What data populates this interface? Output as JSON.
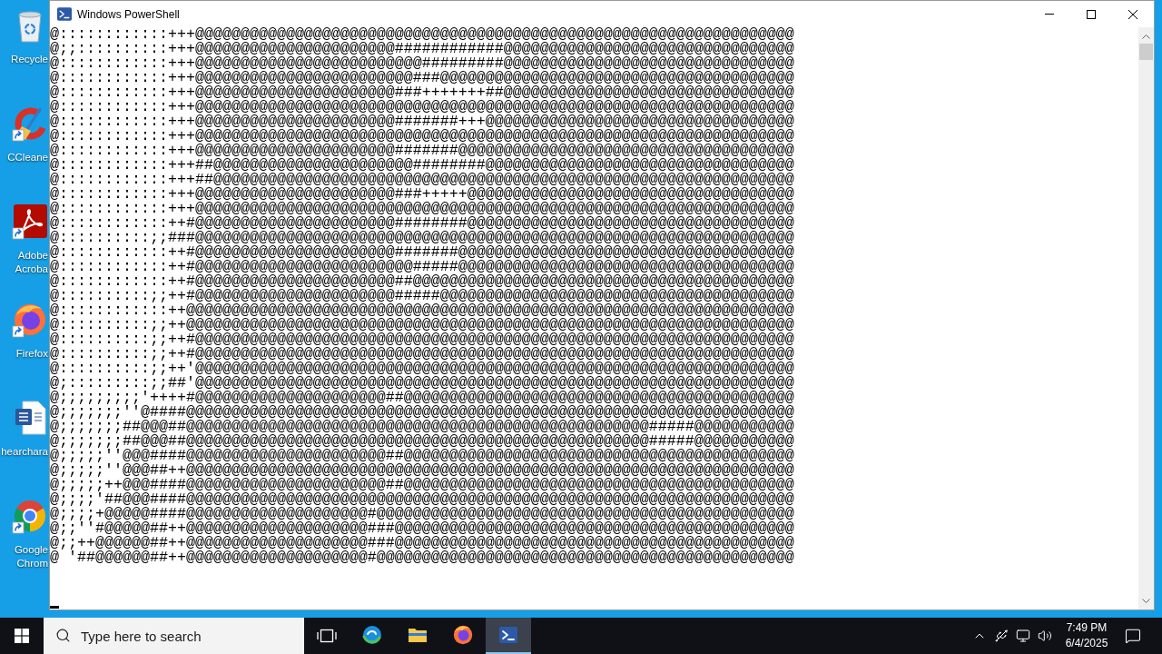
{
  "desktop": {
    "icons": [
      {
        "kind": "bin",
        "shortcut": false,
        "label": [
          "Recycle"
        ]
      },
      {
        "kind": "cleaner",
        "shortcut": true,
        "label": [
          "CCleane"
        ]
      },
      {
        "kind": "pdf",
        "shortcut": true,
        "label": [
          "Adobe",
          "Acroba"
        ]
      },
      {
        "kind": "firefox",
        "shortcut": true,
        "label": [
          "Firefox"
        ]
      },
      {
        "kind": "word",
        "shortcut": false,
        "label": [
          "hearchara"
        ]
      },
      {
        "kind": "chrome",
        "shortcut": true,
        "label": [
          "Google",
          "Chrom"
        ]
      }
    ]
  },
  "window": {
    "title": "Windows PowerShell",
    "console_lines": [
      "@::::::::::::+++@@@@@@@@@@@@@@@@@@@@@@@@@@@@@@@@@@@@@@@@@@@@@@@@@@@@@@@@@@@@@@@@@@",
      "@;;::::::::::+++@@@@@@@@@@@@@@@@@@@@@@############@@@@@@@@@@@@@@@@@@@@@@@@@@@@@@@@",
      "@::::::::::::+++@@@@@@@@@@@@@@@@@@@@@@@@@#########@@@@@@@@@@@@@@@@@@@@@@@@@@@@@@@@",
      "@::::::::::::+++@@@@@@@@@@@@@@@@@@@@@@@@###@@@@@@@@@@@@@@@@@@@@@@@@@@@@@@@@@@@@@@@",
      "@::::::::::::+++@@@@@@@@@@@@@@@@@@@@@@###+++++++##@@@@@@@@@@@@@@@@@@@@@@@@@@@@@@@@",
      "@::::::::::::+++@@@@@@@@@@@@@@@@@@@@@@@@@@@@@@@@@@@@@@@@@@@@@@@@@@@@@@@@@@@@@@@@@@",
      "@::::::::::::+++@@@@@@@@@@@@@@@@@@@@@@#######+++@@@@@@@@@@@@@@@@@@@@@@@@@@@@@@@@@@",
      "@::::::::::::+++@@@@@@@@@@@@@@@@@@@@@@@@@@@@@@@@@@@@@@@@@@@@@@@@@@@@@@@@@@@@@@@@@@",
      "@::::::::::::+++@@@@@@@@@@@@@@@@@@@@@@#######@@@@@@@@@@@@@@@@@@@@@@@@@@@@@@@@@@@@@",
      "@::::::::::::+++##@@@@@@@@@@@@@@@@@@@@@@########@@@@@@@@@@@@@@@@@@@@@@@@@@@@@@@@@@",
      "@::::::::::::+++##@@@@@@@@@@@@@@@@@@@@@@@@@@@@@@@@@@@@@@@@@@@@@@@@@@@@@@@@@@@@@@@@",
      "@::::::::::::+++@@@@@@@@@@@@@@@@@@@@@@###+++++@@@@@@@@@@@@@@@@@@@@@@@@@@@@@@@@@@@@",
      "@::::::::::::+++@@@@@@@@@@@@@@@@@@@@@@@@@@@@@@@@@@@@@@@@@@@@@@@@@@@@@@@@@@@@@@@@@@",
      "@::::::::::::++#@@@@@@@@@@@@@@@@@@@@@@########@@@@@@@@@@@@@@@@@@@@@@@@@@@@@@@@@@@@",
      "@::::::::::;;###@@@@@@@@@@@@@@@@@@@@@@@@@@@@@@@@@@@@@@@@@@@@@@@@@@@@@@@@@@@@@@@@@@",
      "@::::::::::::++#@@@@@@@@@@@@@@@@@@@@@@#######@@@@@@@@@@@@@@@@@@@@@@@@@@@@@@@@@@@@@",
      "@::::::::::::++#@@@@@@@@@@@@@@@@@@@@@@@@#####@@@@@@@@@@@@@@@@@@@@@@@@@@@@@@@@@@@@@",
      "@::::::::::::++#@@@@@@@@@@@@@@@@@@@@@@##@@@@@@@@@@@@@@@@@@@@@@@@@@@@@@@@@@@@@@@@@@",
      "@::::::::::;;++#@@@@@@@@@@@@@@@@@@@@@@#####@@@@@@@@@@@@@@@@@@@@@@@@@@@@@@@@@@@@@@@",
      "@::::::::::::++@@@@@@@@@@@@@@@@@@@@@@@@@@@@@@@@@@@@@@@@@@@@@@@@@@@@@@@@@@@@@@@@@@@",
      "@::::::::::;;++@@@@@@@@@@@@@@@@@@@@@@@@@@@@@@@@@@@@@@@@@@@@@@@@@@@@@@@@@@@@@@@@@@@",
      "@::::::::::;;++#@@@@@@@@@@@@@@@@@@@@@@@@@@@@@@@@@@@@@@@@@@@@@@@@@@@@@@@@@@@@@@@@@@",
      "@::::::::::;;++#@@@@@@@@@@@@@@@@@@@@@@@@@@@@@@@@@@@@@@@@@@@@@@@@@@@@@@@@@@@@@@@@@@",
      "@::::::::::;;++'@@@@@@@@@@@@@@@@@@@@@@@@@@@@@@@@@@@@@@@@@@@@@@@@@@@@@@@@@@@@@@@@@@",
      "@;:::::::::;;##'@@@@@@@@@@@@@@@@@@@@@@@@@@@@@@@@@@@@@@@@@@@@@@@@@@@@@@@@@@@@@@@@@@",
      "@;;;;;;;;;'++++#@@@@@@@@@@@@@@@@@@@@@##@@@@@@@@@@@@@@@@@@@@@@@@@@@@@@@@@@@@@@@@@@@",
      "@;;;;;;;''@####@@@@@@@@@@@@@@@@@@@@@@@@@@@@@@@@@@@@@@@@@@@@@@@@@@@@@@@@@@@@@@@@@@@",
      "@;;;;;;;##@@@##@@@@@@@@@@@@@@@@@@@@@@@@@@@@@@@@@@@@@@@@@@@@@@@@@@@#####@@@@@@@@@@@",
      "@;;;;;;;##@@@##@@@@@@@@@@@@@@@@@@@@@@@@@@@@@@@@@@@@@@@@@@@@@@@@@@@#####@@@@@@@@@@@",
      "@;;;;;''@@@####@@@@@@@@@@@@@@@@@@@@@@##@@@@@@@@@@@@@@@@@@@@@@@@@@@@@@@@@@@@@@@@@@@",
      "@;;;;;''@@@##++@@@@@@@@@@@@@@@@@@@@@@@@@@@@@@@@@@@@@@@@@@@@@@@@@@@@@@@@@@@@@@@@@@@",
      "@;;;;;++@@@####@@@@@@@@@@@@@@@@@@@@@@##@@@@@@@@@@@@@@@@@@@@@@@@@@@@@@@@@@@@@@@@@@@",
      "@;;;;'##@@@####@@@@@@@@@@@@@@@@@@@@@@@@@@@@@@@@@@@@@@@@@@@@@@@@@@@@@@@@@@@@@@@@@@@",
      "@;;;;+@@@@@####@@@@@@@@@@@@@@@@@@@@#@@@@@@@@@@@@@@@@@@@@@@@@@@@@@@@@@@@@@@@@@@@@@@",
      "@;;''#@@@@@##++@@@@@@@@@@@@@@@@@@@@###@@@@@@@@@@@@@@@@@@@@@@@@@@@@@@@@@@@@@@@@@@@@",
      "@;;++@@@@@@##++@@@@@@@@@@@@@@@@@@@@###@@@@@@@@@@@@@@@@@@@@@@@@@@@@@@@@@@@@@@@@@@@@",
      "@ '##@@@@@@##++@@@@@@@@@@@@@@@@@@@@#@@@@@@@@@@@@@@@@@@@@@@@@@@@@@@@@@@@@@@@@@@@@@@"
    ]
  },
  "taskbar": {
    "search": {
      "placeholder": "Type here to search"
    },
    "apps": [
      {
        "kind": "edge",
        "selected": false
      },
      {
        "kind": "explorer",
        "selected": false
      },
      {
        "kind": "firefox",
        "selected": false
      },
      {
        "kind": "powershell",
        "selected": true
      }
    ],
    "clock": {
      "time": "7:49 PM",
      "date": "6/4/2025"
    }
  }
}
